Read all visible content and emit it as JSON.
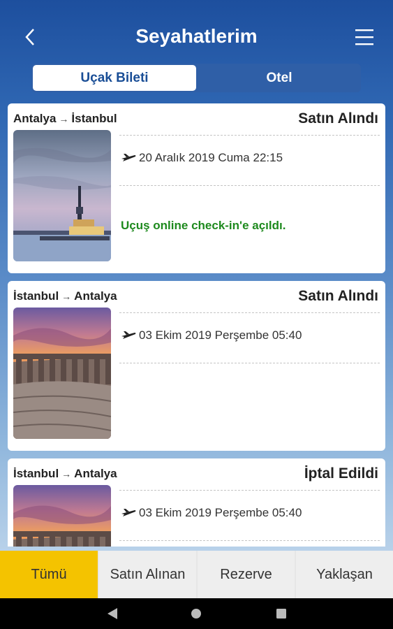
{
  "header": {
    "title": "Seyahatlerim"
  },
  "tabs": {
    "active": "Uçak Bileti",
    "inactive": "Otel"
  },
  "trips": [
    {
      "from": "Antalya",
      "to": "İstanbul",
      "arrow": "→",
      "status": "Satın Alındı",
      "date": "20 Aralık 2019 Cuma 22:15",
      "note": "Uçuş online check-in'e açıldı."
    },
    {
      "from": "İstanbul",
      "to": "Antalya",
      "arrow": "→",
      "status": "Satın Alındı",
      "date": "03 Ekim 2019 Perşembe 05:40",
      "note": ""
    },
    {
      "from": "İstanbul",
      "to": "Antalya",
      "arrow": "→",
      "status": "İptal Edildi",
      "date": "03 Ekim 2019 Perşembe 05:40",
      "note": ""
    }
  ],
  "filters": [
    "Tümü",
    "Satın Alınan",
    "Rezerve",
    "Yaklaşan"
  ],
  "colors": {
    "accent": "#f4c300",
    "note_green": "#1e8a1e",
    "brand_blue": "#1a4e96"
  }
}
